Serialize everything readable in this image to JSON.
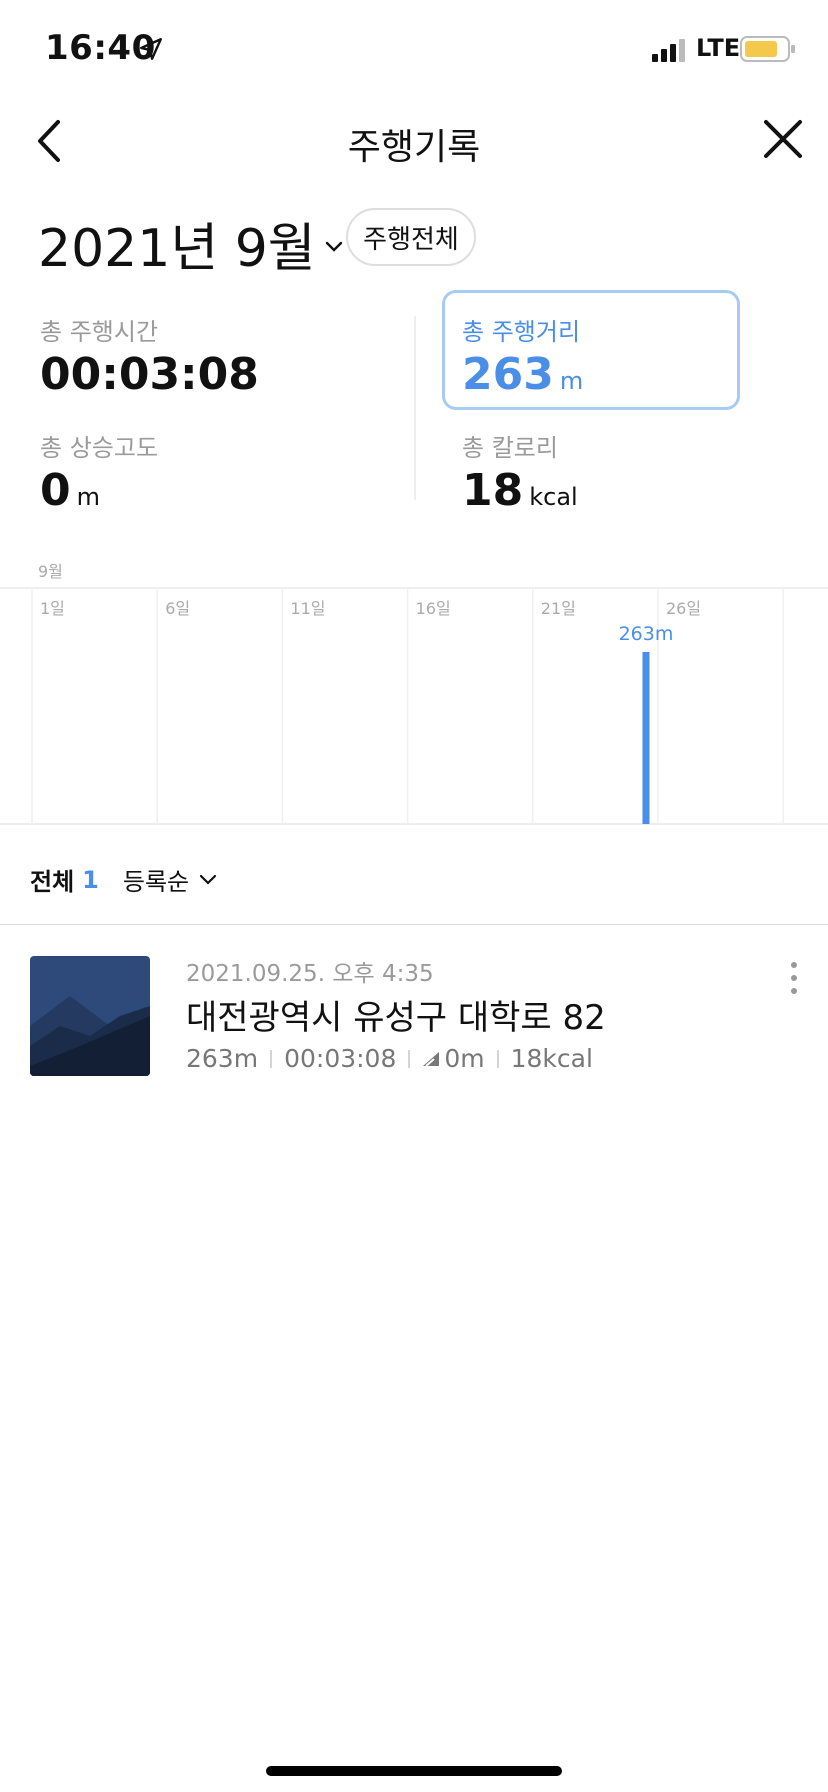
{
  "status_bar": {
    "time": "16:40",
    "network": "LTE",
    "location_icon": "location-arrow-icon"
  },
  "nav": {
    "title": "주행기록",
    "back_icon": "chevron-left-icon",
    "close_icon": "close-icon"
  },
  "period": {
    "month_label": "2021년 9월",
    "filter_label": "주행전체"
  },
  "stats": {
    "time": {
      "label": "총 주행시간",
      "value": "00:03:08"
    },
    "distance": {
      "label": "총 주행거리",
      "value": "263",
      "unit": "m",
      "selected": true
    },
    "elevation": {
      "label": "총 상승고도",
      "value": "0",
      "unit": "m"
    },
    "calories": {
      "label": "총 칼로리",
      "value": "18",
      "unit": "kcal"
    }
  },
  "chart_data": {
    "type": "bar",
    "title": "9월",
    "ticks": [
      "1일",
      "6일",
      "11일",
      "16일",
      "21일",
      "26일"
    ],
    "x": [
      25
    ],
    "values": [
      263
    ],
    "data_label": "263m",
    "xlim": [
      1,
      31
    ],
    "ylim": [
      0,
      263
    ],
    "bar_color": "#4a8ee8"
  },
  "list": {
    "all_label": "전체",
    "count": "1",
    "sort_label": "등록순"
  },
  "records": [
    {
      "date": "2021.09.25. 오후 4:35",
      "title": "대전광역시 유성구 대학로 82",
      "distance": "263m",
      "duration": "00:03:08",
      "elevation": "0m",
      "calories": "18kcal"
    }
  ],
  "colors": {
    "accent": "#4a8ee8",
    "selected_border": "#a6cbf4",
    "battery": "#f4c84a"
  }
}
